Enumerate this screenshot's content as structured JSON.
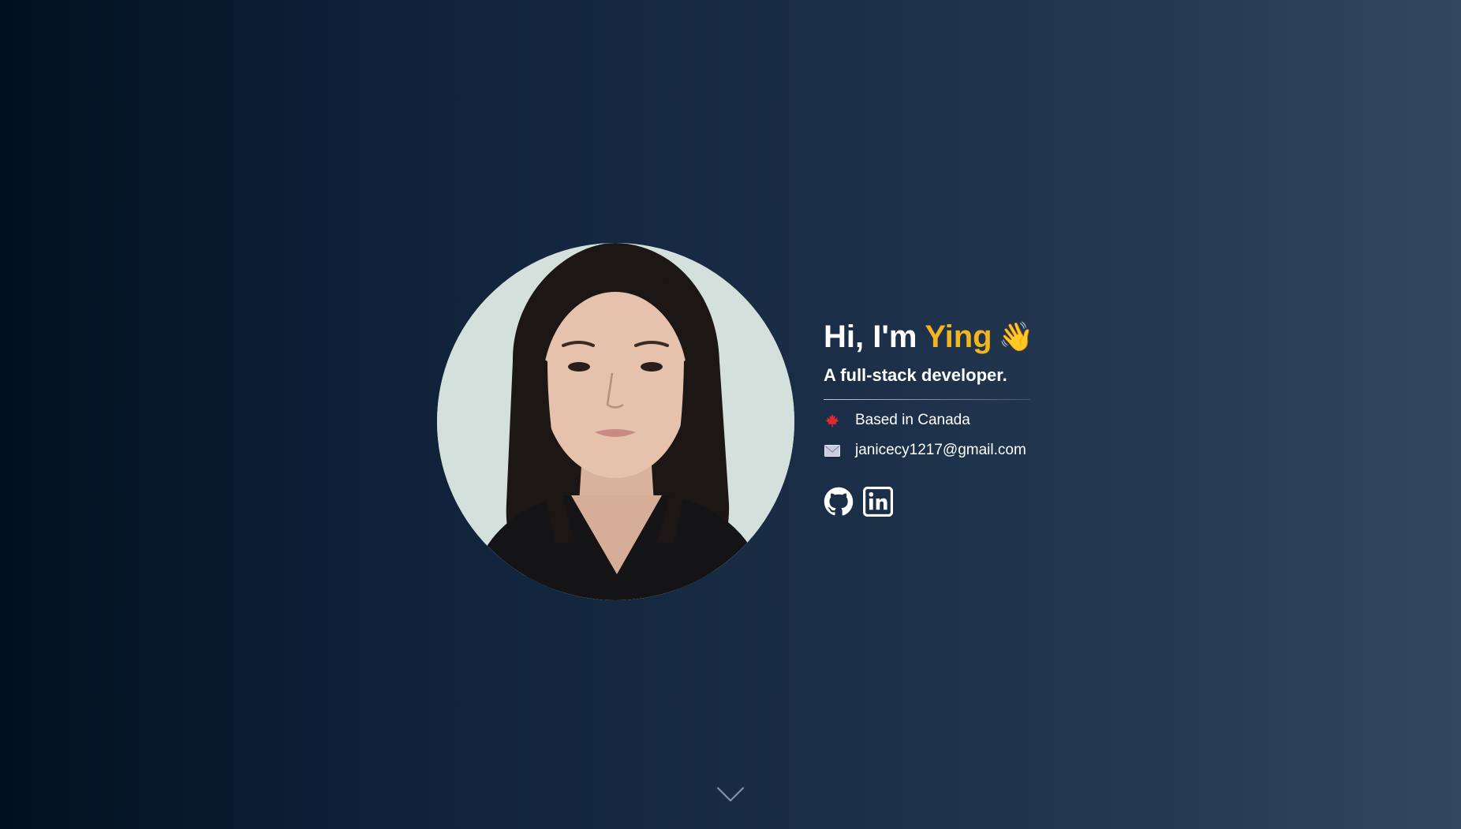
{
  "hero": {
    "greeting_prefix": "Hi, I'm",
    "name": "Ying",
    "wave_emoji": "👋",
    "tagline": "A full-stack developer.",
    "location": "Based in Canada",
    "email": "janicecy1217@gmail.com"
  },
  "icons": {
    "location": "maple-leaf-icon",
    "email": "envelope-icon",
    "social": [
      "github-icon",
      "linkedin-icon"
    ],
    "scroll": "chevron-down-icon"
  },
  "colors": {
    "accent_name": "#f2b41f",
    "maple_leaf": "#e0282e",
    "text": "#ffffff"
  }
}
